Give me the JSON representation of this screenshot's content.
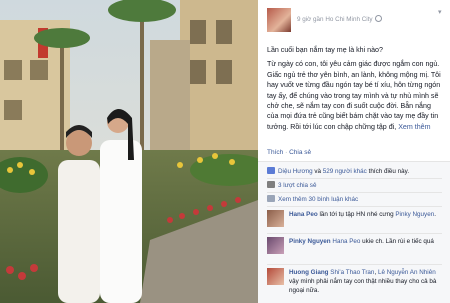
{
  "post": {
    "time": "9 giờ",
    "location_prefix": "gần",
    "location": "Ho Chi Minh City",
    "paragraph1": "Lần cuối bạn nắm tay mẹ là khi nào?",
    "paragraph2": "Từ ngày có con, tôi yêu cảm giác được ngắm con ngủ. Giấc ngủ trẻ thơ yên bình, an lành, không mộng mị. Tôi hay vuốt ve từng đầu ngón tay bé tí xíu, hôn từng ngón tay ấy, để chúng vào trong tay mình và tự nhủ mình sẽ chở che, sẽ nắm tay con đi suốt cuộc đời. Bẵn nắng của mọi đứa trẻ cũng biết bám chặt vào tay mẹ đầy tin tưởng. Rồi tới lúc con chập chững tập đi,",
    "see_more": "Xem thêm"
  },
  "actions": {
    "like": "Thích",
    "share": "Chia sẻ"
  },
  "ufi": {
    "likes_prefix": "Diệu Hương",
    "likes_middle": "và",
    "likes_count": "529 người khác",
    "likes_suffix": "thích điều này.",
    "shares": "3 lượt chia sẻ",
    "view_comments": "Xem thêm 30 bình luận khác"
  },
  "comments": [
    {
      "name": "Hana Peo",
      "text_before": "lần tới tụ tập HN nhé cưng",
      "mention": "Pinky Nguyen",
      "text_after": "."
    },
    {
      "name": "Pinky Nguyen",
      "mention": "Hana Peo",
      "text_after": "ukie ch. Lần rùi e tiếc quá"
    },
    {
      "name": "Huong Giang",
      "mention1": "Shi'a Thao Tran",
      "and": ",",
      "mention2": "Lê Nguyễn An Nhiên",
      "text_after": "vậy mình phải nắm tay con thật nhiều thay cho cả bà ngoại nữa."
    }
  ],
  "colors": {
    "link": "#3b5998",
    "panel_bg": "#ffffff",
    "ufi_bg": "#f6f7f9"
  }
}
